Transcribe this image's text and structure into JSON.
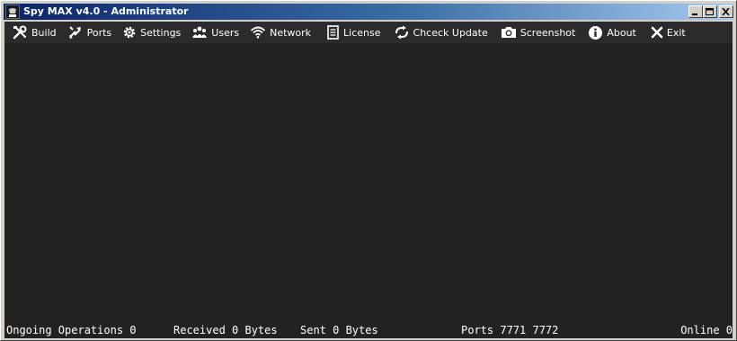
{
  "window": {
    "title": "Spy MAX v4.0 - Administrator",
    "icon": "spy-max-app-icon",
    "controls": [
      "minimize",
      "maximize",
      "close"
    ]
  },
  "toolbar": {
    "items": [
      {
        "label": "Build",
        "icon": "build-tools-icon"
      },
      {
        "label": "Ports",
        "icon": "ports-arrows-icon"
      },
      {
        "label": "Settings",
        "icon": "gear-icon"
      },
      {
        "label": "Users",
        "icon": "users-icon"
      },
      {
        "label": "Network",
        "icon": "wifi-icon"
      },
      {
        "label": "License",
        "icon": "document-icon"
      },
      {
        "label": "Chceck Update",
        "icon": "update-arrows-icon"
      },
      {
        "label": "Screenshot",
        "icon": "camera-icon"
      },
      {
        "label": "About",
        "icon": "info-icon"
      },
      {
        "label": "Exit",
        "icon": "close-x-icon"
      }
    ]
  },
  "status": {
    "ongoing": "Ongoing Operations 0",
    "received": "Received 0 Bytes",
    "sent": "Sent 0 Bytes",
    "ports": "Ports 7771 7772",
    "online": "Online 0"
  },
  "colors": {
    "title_gradient_start": "#0a246a",
    "title_gradient_end": "#a6caf0",
    "toolbar_bg": "#2b2b2b",
    "main_bg": "#222222",
    "text": "#ffffff"
  }
}
